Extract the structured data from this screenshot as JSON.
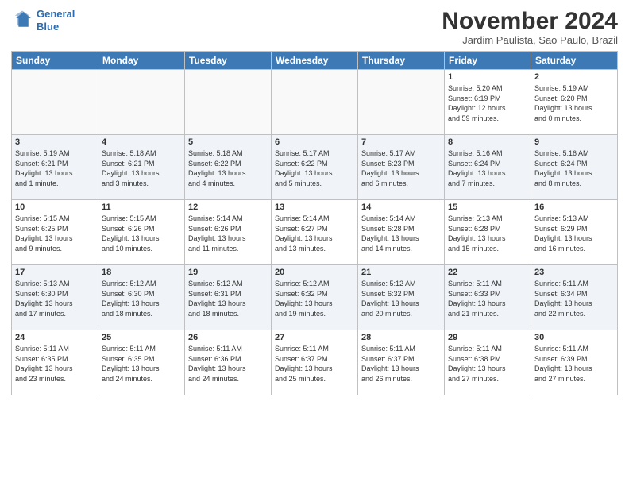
{
  "header": {
    "logo_line1": "General",
    "logo_line2": "Blue",
    "month": "November 2024",
    "location": "Jardim Paulista, Sao Paulo, Brazil"
  },
  "days_of_week": [
    "Sunday",
    "Monday",
    "Tuesday",
    "Wednesday",
    "Thursday",
    "Friday",
    "Saturday"
  ],
  "weeks": [
    [
      {
        "day": "",
        "info": ""
      },
      {
        "day": "",
        "info": ""
      },
      {
        "day": "",
        "info": ""
      },
      {
        "day": "",
        "info": ""
      },
      {
        "day": "",
        "info": ""
      },
      {
        "day": "1",
        "info": "Sunrise: 5:20 AM\nSunset: 6:19 PM\nDaylight: 12 hours\nand 59 minutes."
      },
      {
        "day": "2",
        "info": "Sunrise: 5:19 AM\nSunset: 6:20 PM\nDaylight: 13 hours\nand 0 minutes."
      }
    ],
    [
      {
        "day": "3",
        "info": "Sunrise: 5:19 AM\nSunset: 6:21 PM\nDaylight: 13 hours\nand 1 minute."
      },
      {
        "day": "4",
        "info": "Sunrise: 5:18 AM\nSunset: 6:21 PM\nDaylight: 13 hours\nand 3 minutes."
      },
      {
        "day": "5",
        "info": "Sunrise: 5:18 AM\nSunset: 6:22 PM\nDaylight: 13 hours\nand 4 minutes."
      },
      {
        "day": "6",
        "info": "Sunrise: 5:17 AM\nSunset: 6:22 PM\nDaylight: 13 hours\nand 5 minutes."
      },
      {
        "day": "7",
        "info": "Sunrise: 5:17 AM\nSunset: 6:23 PM\nDaylight: 13 hours\nand 6 minutes."
      },
      {
        "day": "8",
        "info": "Sunrise: 5:16 AM\nSunset: 6:24 PM\nDaylight: 13 hours\nand 7 minutes."
      },
      {
        "day": "9",
        "info": "Sunrise: 5:16 AM\nSunset: 6:24 PM\nDaylight: 13 hours\nand 8 minutes."
      }
    ],
    [
      {
        "day": "10",
        "info": "Sunrise: 5:15 AM\nSunset: 6:25 PM\nDaylight: 13 hours\nand 9 minutes."
      },
      {
        "day": "11",
        "info": "Sunrise: 5:15 AM\nSunset: 6:26 PM\nDaylight: 13 hours\nand 10 minutes."
      },
      {
        "day": "12",
        "info": "Sunrise: 5:14 AM\nSunset: 6:26 PM\nDaylight: 13 hours\nand 11 minutes."
      },
      {
        "day": "13",
        "info": "Sunrise: 5:14 AM\nSunset: 6:27 PM\nDaylight: 13 hours\nand 13 minutes."
      },
      {
        "day": "14",
        "info": "Sunrise: 5:14 AM\nSunset: 6:28 PM\nDaylight: 13 hours\nand 14 minutes."
      },
      {
        "day": "15",
        "info": "Sunrise: 5:13 AM\nSunset: 6:28 PM\nDaylight: 13 hours\nand 15 minutes."
      },
      {
        "day": "16",
        "info": "Sunrise: 5:13 AM\nSunset: 6:29 PM\nDaylight: 13 hours\nand 16 minutes."
      }
    ],
    [
      {
        "day": "17",
        "info": "Sunrise: 5:13 AM\nSunset: 6:30 PM\nDaylight: 13 hours\nand 17 minutes."
      },
      {
        "day": "18",
        "info": "Sunrise: 5:12 AM\nSunset: 6:30 PM\nDaylight: 13 hours\nand 18 minutes."
      },
      {
        "day": "19",
        "info": "Sunrise: 5:12 AM\nSunset: 6:31 PM\nDaylight: 13 hours\nand 18 minutes."
      },
      {
        "day": "20",
        "info": "Sunrise: 5:12 AM\nSunset: 6:32 PM\nDaylight: 13 hours\nand 19 minutes."
      },
      {
        "day": "21",
        "info": "Sunrise: 5:12 AM\nSunset: 6:32 PM\nDaylight: 13 hours\nand 20 minutes."
      },
      {
        "day": "22",
        "info": "Sunrise: 5:11 AM\nSunset: 6:33 PM\nDaylight: 13 hours\nand 21 minutes."
      },
      {
        "day": "23",
        "info": "Sunrise: 5:11 AM\nSunset: 6:34 PM\nDaylight: 13 hours\nand 22 minutes."
      }
    ],
    [
      {
        "day": "24",
        "info": "Sunrise: 5:11 AM\nSunset: 6:35 PM\nDaylight: 13 hours\nand 23 minutes."
      },
      {
        "day": "25",
        "info": "Sunrise: 5:11 AM\nSunset: 6:35 PM\nDaylight: 13 hours\nand 24 minutes."
      },
      {
        "day": "26",
        "info": "Sunrise: 5:11 AM\nSunset: 6:36 PM\nDaylight: 13 hours\nand 24 minutes."
      },
      {
        "day": "27",
        "info": "Sunrise: 5:11 AM\nSunset: 6:37 PM\nDaylight: 13 hours\nand 25 minutes."
      },
      {
        "day": "28",
        "info": "Sunrise: 5:11 AM\nSunset: 6:37 PM\nDaylight: 13 hours\nand 26 minutes."
      },
      {
        "day": "29",
        "info": "Sunrise: 5:11 AM\nSunset: 6:38 PM\nDaylight: 13 hours\nand 27 minutes."
      },
      {
        "day": "30",
        "info": "Sunrise: 5:11 AM\nSunset: 6:39 PM\nDaylight: 13 hours\nand 27 minutes."
      }
    ]
  ]
}
